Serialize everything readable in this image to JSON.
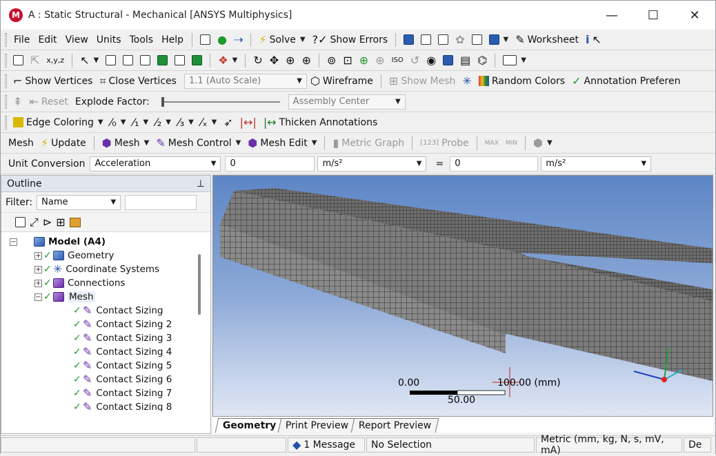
{
  "window": {
    "title": "A : Static Structural - Mechanical [ANSYS Multiphysics]",
    "logo_letter": "M",
    "controls": {
      "minimize": "—",
      "maximize": "☐",
      "close": "✕"
    }
  },
  "menubar": {
    "items": [
      "File",
      "Edit",
      "View",
      "Units",
      "Tools",
      "Help"
    ],
    "solve_label": "Solve",
    "show_errors_label": "Show Errors",
    "worksheet_label": "Worksheet",
    "info_glyph": "i"
  },
  "graphics_toolbar": {
    "icons": [
      "select-mode-icon",
      "pan-icon",
      "rotate-icon",
      "zoom-icon",
      "box-zoom-icon",
      "fit-icon",
      "iso-icon"
    ]
  },
  "vertex_toolbar": {
    "show_vertices_label": "Show Vertices",
    "close_vertices_label": "Close Vertices",
    "scale_value": "1.1 (Auto Scale)",
    "wireframe_label": "Wireframe",
    "show_mesh_label": "Show Mesh",
    "random_colors_label": "Random Colors",
    "annotation_label": "Annotation Preferen"
  },
  "explode_toolbar": {
    "reset_label": "Reset",
    "explode_factor_label": "Explode Factor:",
    "assembly_center_value": "Assembly Center"
  },
  "edge_toolbar": {
    "edge_coloring_label": "Edge Coloring",
    "thicken_annotations_label": "Thicken Annotations"
  },
  "mesh_toolbar": {
    "mesh_label": "Mesh",
    "update_label": "Update",
    "mesh_button_label": "Mesh",
    "mesh_control_label": "Mesh Control",
    "mesh_edit_label": "Mesh Edit",
    "metric_graph_label": "Metric Graph",
    "probe_label": "Probe",
    "max_label": "MAX",
    "min_label": "MIN"
  },
  "unit_conversion": {
    "label": "Unit Conversion",
    "quantity": "Acceleration",
    "input_value": "0",
    "input_unit": "m/s²",
    "equals": "=",
    "output_value": "0",
    "output_unit": "m/s²"
  },
  "outline": {
    "title": "Outline",
    "pin_glyph": "⊥",
    "filter_label": "Filter:",
    "filter_value": "Name",
    "tree": [
      {
        "label": "Model (A4)",
        "bold": true
      },
      {
        "label": "Geometry"
      },
      {
        "label": "Coordinate Systems"
      },
      {
        "label": "Connections"
      },
      {
        "label": "Mesh"
      },
      {
        "label": "Contact Sizing"
      },
      {
        "label": "Contact Sizing 2"
      },
      {
        "label": "Contact Sizing 3"
      },
      {
        "label": "Contact Sizing 4"
      },
      {
        "label": "Contact Sizing 5"
      },
      {
        "label": "Contact Sizing 6"
      },
      {
        "label": "Contact Sizing 7"
      },
      {
        "label": "Contact Sizing 8"
      }
    ]
  },
  "viewport": {
    "scale_left": "0.00",
    "scale_right": "100.00 (mm)",
    "scale_mid": "50.00",
    "tabs": [
      "Geometry",
      "Print Preview",
      "Report Preview"
    ],
    "active_tab": "Geometry"
  },
  "statusbar": {
    "messages": "1 Message",
    "selection": "No Selection",
    "units": "Metric (mm, kg, N, s, mV, mA)",
    "extra": "De"
  }
}
